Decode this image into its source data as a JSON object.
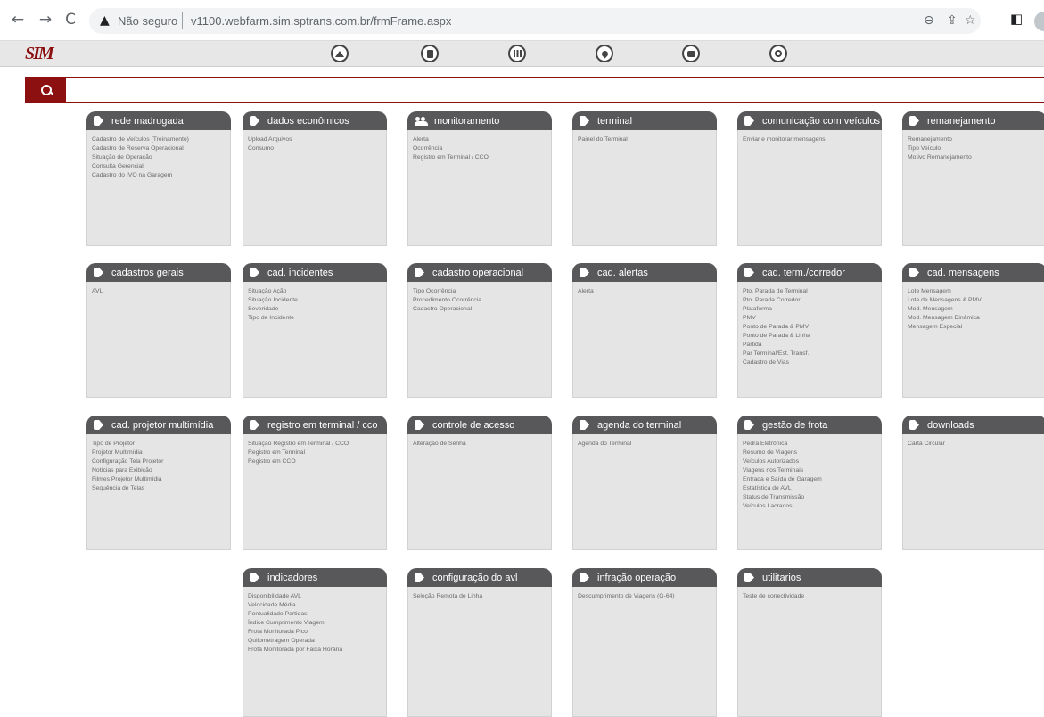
{
  "browser": {
    "back_icon": "←",
    "forward_icon": "→",
    "reload_icon": "C",
    "warning_icon": "▲",
    "security_label": "Não seguro",
    "url": "v1100.webfarm.sim.sptrans.com.br/frmFrame.aspx"
  },
  "app": {
    "logo": "SIM",
    "nav_icons": [
      "home-icon",
      "document-icon",
      "chart-icon",
      "location-icon",
      "message-icon",
      "logout-icon"
    ],
    "accent_color": "#8c1010",
    "header_color": "#58585a"
  },
  "search": {
    "value": "",
    "placeholder": ""
  },
  "cards": [
    {
      "title": "rede madrugada",
      "items": [
        "Cadastro de Veículos (Treinamento)",
        "Cadastro de Reserva Operacional",
        "Situação de Operação",
        "Consulta Gerencial",
        "Cadastro do IVO na Garagem"
      ]
    },
    {
      "title": "dados econômicos",
      "items": [
        "Upload Arquivos",
        "Consumo"
      ]
    },
    {
      "title": "monitoramento",
      "items": [
        "Alerta",
        "Ocorrência",
        "Registro em Terminal / CCO"
      ]
    },
    {
      "title": "terminal",
      "items": [
        "Painel do Terminal"
      ]
    },
    {
      "title": "comunicação com veículos",
      "items": [
        "Enviar e monitorar mensagens"
      ]
    },
    {
      "title": "remanejamento",
      "items": [
        "Remanejamento",
        "Tipo Veículo",
        "Motivo Remanejamento"
      ]
    },
    {
      "title": "cadastros gerais",
      "items": [
        "AVL"
      ]
    },
    {
      "title": "cad. incidentes",
      "items": [
        "Situação Ação",
        "Situação Incidente",
        "Severidade",
        "Tipo de Incidente"
      ]
    },
    {
      "title": "cadastro operacional",
      "items": [
        "Tipo Ocorrência",
        "Procedimento Ocorrência",
        "Cadastro Operacional"
      ]
    },
    {
      "title": "cad. alertas",
      "items": [
        "Alerta"
      ]
    },
    {
      "title": "cad. term./corredor",
      "items": [
        "Pto. Parada de Terminal",
        "Pto. Parada Corredor",
        "Plataforma",
        "PMV",
        "Ponto de Parada & PMV",
        "Ponto de Parada & Linha",
        "Partida",
        "Par Terminal/Est. Transf.",
        "Cadastro de Vias"
      ]
    },
    {
      "title": "cad. mensagens",
      "items": [
        "Lote Mensagem",
        "Lote de Mensagens & PMV",
        "Mod. Mensagem",
        "Mod. Mensagem Dinâmica",
        "Mensagem Especial"
      ]
    },
    {
      "title": "cad. projetor multimídia",
      "items": [
        "Tipo de Projetor",
        "Projetor Multimídia",
        "Configuração Tela Projetor",
        "Notícias para Exibição",
        "Filmes Projetor Multimídia",
        "Sequência de Telas"
      ]
    },
    {
      "title": "registro em terminal / cco",
      "items": [
        "Situação Registro em Terminal / CCO",
        "Registro em Terminal",
        "Registro em CCO"
      ]
    },
    {
      "title": "controle de acesso",
      "items": [
        "Alteração de Senha"
      ]
    },
    {
      "title": "agenda do terminal",
      "items": [
        "Agenda do Terminal"
      ]
    },
    {
      "title": "gestão de frota",
      "items": [
        "Pedra Eletrônica",
        "Resumo de Viagens",
        "Veículos Autorizados",
        "Viagens nos Terminais",
        "Entrada e Saída de Garagem",
        "Estatística de AVL",
        "Status de Transmissão",
        "Veículos Lacrados"
      ]
    },
    {
      "title": "downloads",
      "items": [
        "Carta Circular"
      ]
    },
    {
      "title": "indicadores",
      "items": [
        "Disponibilidade AVL",
        "Velocidade Média",
        "Pontualidade Partidas",
        "Índice Cumprimento Viagem",
        "Frota Monitorada Pico",
        "Quilometragem Operada",
        "Frota Monitorada por Faixa Horária"
      ]
    },
    {
      "title": "configuração do avl",
      "items": [
        "Seleção Remota de Linha"
      ]
    },
    {
      "title": "infração operação",
      "items": [
        "Descumprimento de Viagens (G-64)"
      ]
    },
    {
      "title": "utilitarios",
      "items": [
        "Teste de conectividade"
      ]
    }
  ]
}
